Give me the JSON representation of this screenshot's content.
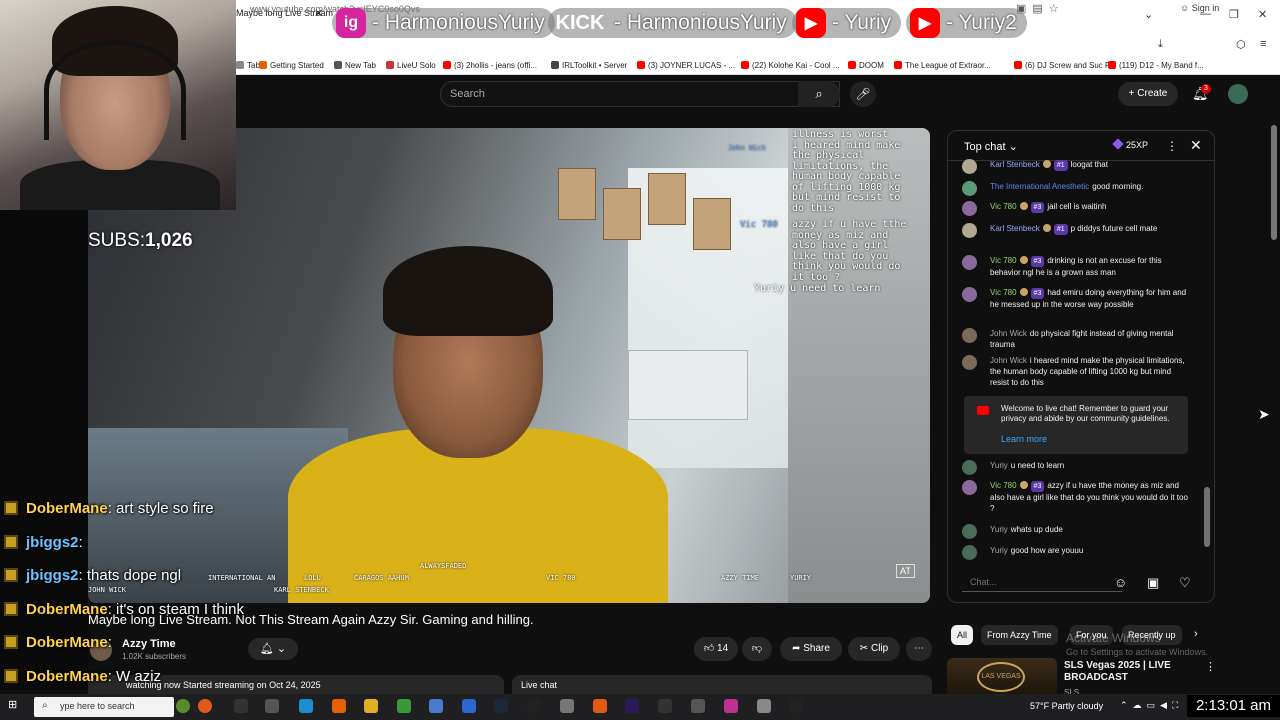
{
  "browser": {
    "tab_title": "Maybe long Live Stream",
    "url": "www.youtube.com/watch?v=lEYC0so0Qvs",
    "signin": "Sign in",
    "bookmarks": [
      {
        "label": "Tab",
        "color": "#888888"
      },
      {
        "label": "Getting Started",
        "color": "#e66000"
      },
      {
        "label": "New Tab",
        "color": "#555555"
      },
      {
        "label": "LiveU Solo",
        "color": "#cc3333"
      },
      {
        "label": "(3) 2hollis - jeans (offi...",
        "color": "#ff0000"
      },
      {
        "label": "IRLToolkit • Server",
        "color": "#444444"
      },
      {
        "label": "(3) JOYNER LUCAS - ...",
        "color": "#ff0000"
      },
      {
        "label": "(22) Kolohe Kai - Cool ...",
        "color": "#ff0000"
      },
      {
        "label": "DOOM",
        "color": "#ff0000"
      },
      {
        "label": "The League of Extraor...",
        "color": "#ff0000"
      },
      {
        "label": "(6) DJ Screw and Suc F...",
        "color": "#ff0000"
      },
      {
        "label": "(119) D12 - My Band f...",
        "color": "#ff0000"
      }
    ]
  },
  "overlay": {
    "banners": [
      {
        "logo": "ig",
        "color": "#d6249f",
        "text": "- HarmoniousYuriy"
      },
      {
        "logo": "KICK",
        "color": "#53fc18",
        "text": "- HarmoniousYuriy"
      },
      {
        "logo": "▶",
        "color": "#ff0000",
        "text": "- Yuriy"
      },
      {
        "logo": "▶",
        "color": "#ff0000",
        "text": "- Yuriy2"
      }
    ],
    "subs_label": "SUBS:",
    "subs_count": "1,026",
    "chat": [
      {
        "user": "DoberMane",
        "color": "#ffd24a",
        "msg": ": art style so fire"
      },
      {
        "user": "jbiggs2",
        "color": "#6ec3ff",
        "msg": ":"
      },
      {
        "user": "jbiggs2",
        "color": "#6ec3ff",
        "msg": ": thats dope ngl"
      },
      {
        "user": "DoberMane",
        "color": "#ffd24a",
        "msg": ": it's on steam I think"
      },
      {
        "user": "DoberMane",
        "color": "#ffd24a",
        "msg": ":"
      },
      {
        "user": "DoberMane",
        "color": "#ffd24a",
        "msg": ": W aziz"
      }
    ]
  },
  "yt_header": {
    "search_placeholder": "Search",
    "create_label": "Create",
    "notif_count": "3"
  },
  "video": {
    "overlay_text": "illness is worst\ni heared mind make\nthe physical\nlimitations, the\nhuman body capable\nof lifting 1000 kg\nbut mind resist to\ndo this",
    "overlay_text2": "azzy if u have tthe\nmoney as miz and\nalso have a girl\nlike that do you\nthink you would do\nit too ?",
    "overlay_learn": "Yuriy u need to learn",
    "name_john": "John Wick",
    "name_vic": "Vic 780",
    "bottom_names": [
      "ALWAYSFADED",
      "INTERNATIONAL AN",
      "LOLU",
      "CARAGOS AAHUM",
      "KARL STENBECK",
      "VIC 780",
      "AZZY TIME",
      "YURIY",
      "JOHN WICK"
    ],
    "title": "Maybe long Live Stream. Not This Stream Again Azzy Sir. Gaming and  hilling.",
    "channel_name": "Azzy Time",
    "channel_subs": "1.02K subscribers",
    "likes": "14",
    "share_label": "Share",
    "clip_label": "Clip",
    "watching": "watching now  Started streaming on Oct 24, 2025",
    "live_chat_tab": "Live chat"
  },
  "chat_panel": {
    "header": "Top chat",
    "xp": "25XP",
    "messages": [
      {
        "author": "Karl Stenbeck",
        "style": "",
        "rank": "#1",
        "coin": true,
        "text": "loogat that",
        "avatar": "#b0a890"
      },
      {
        "author": "The International Anesthetic",
        "style": "blue",
        "rank": "",
        "coin": false,
        "text": "good morning.",
        "avatar": "#5a9a7a"
      },
      {
        "author": "Vic 780",
        "style": "green",
        "rank": "#3",
        "coin": true,
        "text": "jail cell is waitinh",
        "avatar": "#8a6a9a"
      },
      {
        "author": "Karl Stenbeck",
        "style": "",
        "rank": "#1",
        "coin": true,
        "text": "p diddys future cell mate",
        "avatar": "#b0a890"
      },
      {
        "author": "Vic 780",
        "style": "green",
        "rank": "#3",
        "coin": true,
        "text": "drinking is not an excuse for this behavior ngl he is a grown ass man",
        "avatar": "#8a6a9a"
      },
      {
        "author": "Vic 780",
        "style": "green",
        "rank": "#3",
        "coin": true,
        "text": "had emiru doing everything for him and he messed up in the worse way possible",
        "avatar": "#8a6a9a"
      },
      {
        "author": "John Wick",
        "style": "grey",
        "rank": "",
        "coin": false,
        "text": "do physical fight instead of giving mental trauma",
        "avatar": "#7a6a5a"
      },
      {
        "author": "John Wick",
        "style": "grey",
        "rank": "",
        "coin": false,
        "text": "i heared mind make the physical limitations, the human body capable of lifting 1000 kg but mind resist to do this",
        "avatar": "#7a6a5a"
      },
      {
        "author": "Yuriy",
        "style": "grey",
        "rank": "",
        "coin": false,
        "text": "u need to learn",
        "avatar": "#4a6a5a"
      },
      {
        "author": "Vic 780",
        "style": "green",
        "rank": "#3",
        "coin": true,
        "text": "azzy if u have tthe money as miz and also have a girl like that do you think you would do it too ?",
        "avatar": "#8a6a9a"
      },
      {
        "author": "Yuriy",
        "style": "grey",
        "rank": "",
        "coin": false,
        "text": "whats up dude",
        "avatar": "#4a6a5a"
      },
      {
        "author": "Yuriy",
        "style": "grey",
        "rank": "",
        "coin": false,
        "text": "good how are youuu",
        "avatar": "#4a6a5a"
      }
    ],
    "welcome": "Welcome to live chat! Remember to guard your privacy and abide by our community guidelines.",
    "learn_more": "Learn more",
    "input_placeholder": "Chat..."
  },
  "chips": [
    "All",
    "From Azzy Time",
    "For you",
    "Recently up"
  ],
  "recommendation": {
    "logo": "LAS VEGAS",
    "title": "SLS Vegas 2025 | LIVE BROADCAST",
    "sub": "SLS"
  },
  "windows": {
    "activate": "Activate Windows",
    "activate_sub": "Go to Settings to activate Windows.",
    "search": "ype here to search",
    "weather": "57°F  Partly cloudy",
    "clock": "2:13:01 am"
  }
}
